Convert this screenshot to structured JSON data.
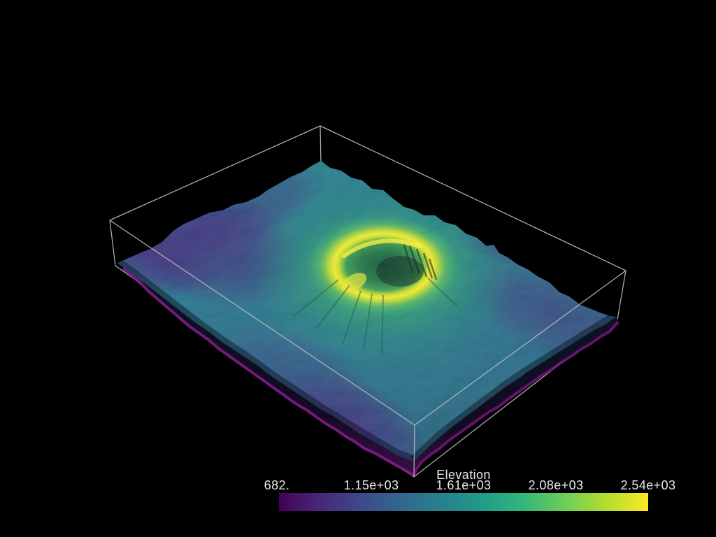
{
  "window": {
    "background_color": "#000000",
    "description": "3D scientific visualization viewport (VTK/PyVista style) showing a warped elevation surface of a volcano with breached crater, inside a white bounding-box outline, with a horizontal scalar colorbar at the bottom"
  },
  "chart_data": {
    "type": "heatmap",
    "subtype": "3d-elevation-surface",
    "title": "Elevation",
    "colorbar": {
      "title": "Elevation",
      "orientation": "horizontal",
      "ticks": [
        "682.",
        "1.15e+03",
        "1.61e+03",
        "2.08e+03",
        "2.54e+03"
      ],
      "ticks_numeric": [
        682,
        1150,
        1610,
        2080,
        2540
      ],
      "range": [
        682,
        2540
      ],
      "colormap": "viridis",
      "colormap_stops": [
        "#440154",
        "#482878",
        "#3e4989",
        "#31688e",
        "#26828e",
        "#1f9e89",
        "#35b779",
        "#6ece58",
        "#b5de2b",
        "#fde725"
      ]
    },
    "scene": {
      "subject": "volcano terrain elevation model with horseshoe crater rim (highest elevation, yellow) sloping to low plains (purple)",
      "outline_color": "#b9b9b9",
      "background": "#000000",
      "label_color": "#e9e9e9",
      "base_side_color": "#8b1b8f",
      "legend_on": true,
      "grid_on": false
    }
  }
}
